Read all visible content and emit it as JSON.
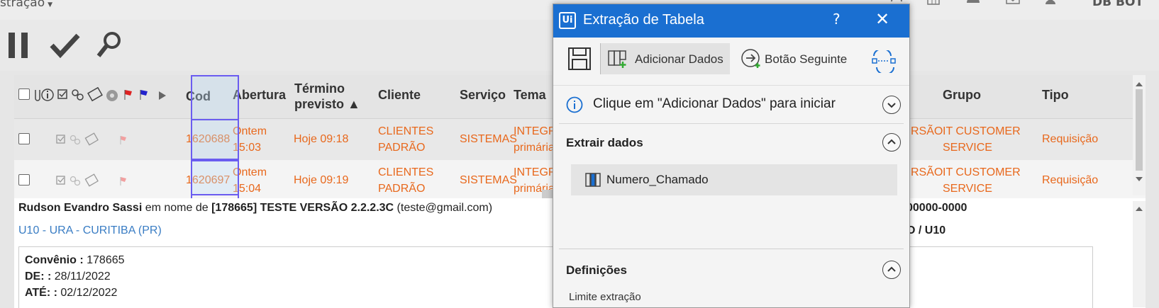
{
  "topbar": {
    "menu_label": "stração",
    "user_label": "DB BOT"
  },
  "grid": {
    "headers": {
      "cod": "Cod",
      "abertura": "Abertura",
      "termino_1": "Término",
      "termino_2": "previsto ▲",
      "cliente": "Cliente",
      "servico": "Serviço",
      "tema": "Tema",
      "grupo": "Grupo",
      "tipo": "Tipo"
    },
    "rows": [
      {
        "cod": "1620688",
        "abertura_1": "Ontem",
        "abertura_2": "15:03",
        "termino": "Hoje 09:18",
        "cliente_1": "CLIENTES",
        "cliente_2": "PADRÃO",
        "servico": "SISTEMAS",
        "tema_1": "INTEGR",
        "tema_2": "primária",
        "versao": "RSÃO",
        "grupo_1": "IT CUSTOMER",
        "grupo_2": "SERVICE",
        "tipo": "Requisição"
      },
      {
        "cod": "1620697",
        "abertura_1": "Ontem",
        "abertura_2": "15:04",
        "termino": "Hoje 09:19",
        "cliente_1": "CLIENTES",
        "cliente_2": "PADRÃO",
        "servico": "SISTEMAS",
        "tema_1": "INTEGR",
        "tema_2": "primária",
        "versao": "RSÃO",
        "grupo_1": "IT CUSTOMER",
        "grupo_2": "SERVICE",
        "tipo": "Requisição"
      }
    ]
  },
  "detail": {
    "requester": "Rudson Evandro Sassi",
    "on_behalf": " em nome de ",
    "org": "[178665] TESTE VERSÃO 2.2.2.3C",
    "email": " (teste@gmail.com)",
    "location": "U10 - URA - CURITIBA (PR)",
    "right_1": "00000-0000",
    "right_2": "O / U10",
    "fields": [
      {
        "label": "Convênio :",
        "value": " 178665"
      },
      {
        "label": "DE: :",
        "value": " 28/11/2022"
      },
      {
        "label": "ATÉ: :",
        "value": " 02/12/2022"
      }
    ]
  },
  "dialog": {
    "title": "Extração de Tabela",
    "logo": "Ui",
    "help": "?",
    "close": "✕",
    "add_data": "Adicionar Dados",
    "next_button": "Botão Seguinte",
    "info_message": "Clique em \"Adicionar Dados\" para iniciar",
    "extract_section": "Extrair dados",
    "extract_item": "Numero_Chamado",
    "settings_section": "Definições",
    "settings_partial": "Limite extração"
  },
  "colors": {
    "accent_blue": "#1a6fd1",
    "row_text_orange": "#e8681c",
    "highlight_border": "#6a5cf0"
  }
}
